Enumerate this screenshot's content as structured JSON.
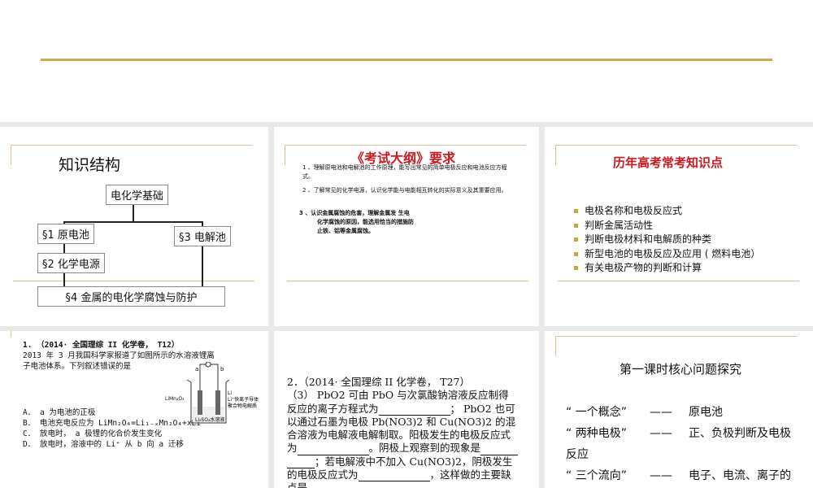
{
  "slide1": {
    "title": "知识结构",
    "root": "电化学基础",
    "n1": "§1 原电池",
    "n2": "§2 化学电源",
    "n3": "§3 电解池",
    "n4": "§4 金属的电化学腐蚀与防护"
  },
  "slide2": {
    "title": "《考试大纲》要求",
    "items": [
      "1 、理解原电池和电解池的工作原理，能写出常见的简单电极反应和电池反应方程式。",
      "2 、了解常见的化学电源，认识化学能与电能相互转化的实际意义及其重要应用。"
    ],
    "item3": [
      "3 、认识金属腐蚀的危害，理解金属发  生电",
      "化学腐蚀的原因，能选用恰当的措施防",
      "止铁、铝等金属腐蚀。"
    ]
  },
  "slide3": {
    "title": "历年高考常考知识点",
    "items": [
      "电极名称和电极反应式",
      "判断金属活动性",
      "判断电极材料和电解质的种类",
      "新型电池的电极反应及应用 ( 燃料电池）",
      "有关电极产物的判断和计算"
    ]
  },
  "slide4": {
    "head": "1. （2014· 全国理综 II 化学卷， T12）",
    "stem": [
      "2013 年 3 月我国科学家报道了如图所示的水溶液锂离",
      "子电池体系。下列叙述错误的是"
    ],
    "options": [
      "A． a 为电池的正极",
      "B． 电池充电反应为 LiMn₂O₄=Li₁₋ₓMn₂O₄+xLi",
      "C． 放电时， a 极锂的化合价发生变化",
      "D． 放电时，溶液中的 Li⁺ 从 b 向 a 迁移"
    ],
    "fig": {
      "a": "a",
      "b": "b",
      "left": "LiMn₂O₄",
      "r1": "Li",
      "r2": "Li⁺快离子导体",
      "r3": "聚合物电解质",
      "sol": "Li₂SO₄水溶液"
    }
  },
  "slide5": {
    "lines": [
      "2．（2014· 全国理综 II 化学卷， T27）",
      "（3） PbO2 可由 PbO 与次氯酸钠溶液反应制得",
      "反应的离子方程式为",
      "；  PbO2 也可",
      "以通过石墨为电极 Pb(NO3)2 和 Cu(NO3)2 的混",
      "合溶液为电解液电解制取。阳极发生的电极反应式",
      "为",
      "。阴极上观察到的现象是",
      "；若电解液中不加入 Cu(NO3)2，阴极发生",
      "的电极反应式为",
      "，这样做的主要缺",
      "点是",
      "。"
    ]
  },
  "slide6": {
    "title": "第一课时核心问题探究",
    "rows": [
      [
        "“ 一个概念”",
        "——",
        "原电池"
      ],
      [
        "“ 两种电极”",
        "——",
        "正、负极判断及电极"
      ],
      [
        "反应"
      ],
      [
        "“ 三个流向”",
        "——",
        "电子、电流、离子的"
      ]
    ]
  }
}
